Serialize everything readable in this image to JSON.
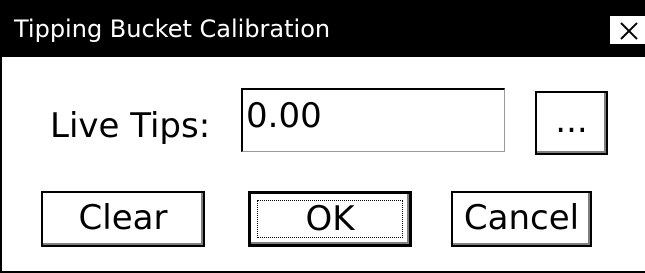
{
  "window": {
    "title": "Tipping Bucket Calibration",
    "close_icon": "close-icon"
  },
  "form": {
    "live_tips_label": "Live Tips:",
    "live_tips_value": "0.00",
    "browse_label": "..."
  },
  "buttons": {
    "clear": "Clear",
    "ok": "OK",
    "cancel": "Cancel"
  }
}
